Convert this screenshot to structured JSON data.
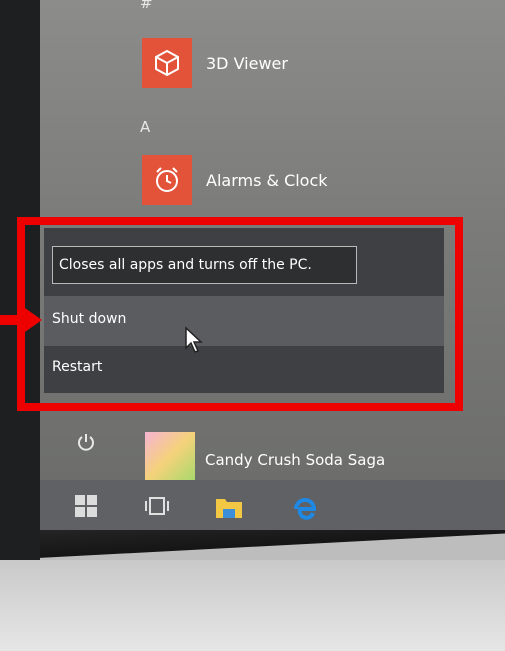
{
  "start_menu": {
    "section_hash": "#",
    "section_a": "A",
    "apps": [
      {
        "label": "3D Viewer",
        "icon": "cube-icon"
      },
      {
        "label": "Alarms & Clock",
        "icon": "alarm-clock-icon"
      },
      {
        "label": "Candy Crush Soda Saga",
        "icon": "candy-crush-icon"
      }
    ]
  },
  "power_menu": {
    "tooltip": "Closes all apps and turns off the PC.",
    "items": [
      {
        "label": "Shut down"
      },
      {
        "label": "Restart"
      }
    ]
  },
  "taskbar": {
    "icons": [
      "windows-start-icon",
      "task-view-icon",
      "file-explorer-icon",
      "edge-icon"
    ]
  },
  "colors": {
    "highlight": "#ee0000",
    "tile_orange": "#e2533a",
    "menu_bg": "#3f4043"
  }
}
